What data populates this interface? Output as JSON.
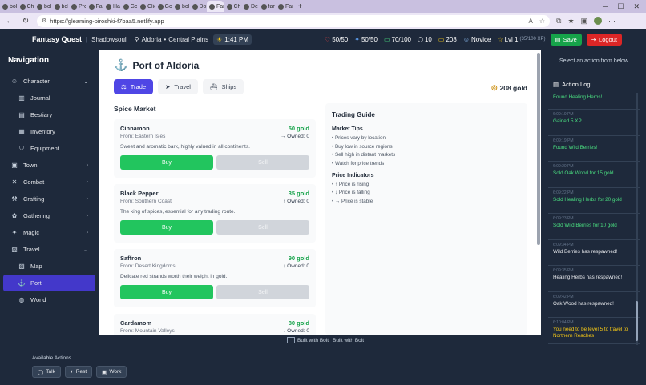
{
  "browser": {
    "tabs": [
      {
        "label": "bolt"
      },
      {
        "label": "Cha"
      },
      {
        "label": "bolt"
      },
      {
        "label": "bolt"
      },
      {
        "label": "Proj"
      },
      {
        "label": "Fant"
      },
      {
        "label": "Hac"
      },
      {
        "label": "Goo"
      },
      {
        "label": "Clie"
      },
      {
        "label": "Goo"
      },
      {
        "label": "bolt"
      },
      {
        "label": "Dom"
      },
      {
        "label": "Fant",
        "active": true
      },
      {
        "label": "Cha"
      },
      {
        "label": "Dev"
      },
      {
        "label": "fant"
      },
      {
        "label": "Fant"
      }
    ],
    "url": "https://gleaming-piroshki-f7baa5.netlify.app"
  },
  "header": {
    "brand": "Fantasy Quest",
    "player": "Shadowsoul",
    "location": "Aldoria",
    "region": "Central Plains",
    "time": "1:41 PM",
    "hp": "50/50",
    "mana": "50/50",
    "stamina": "70/100",
    "stat_o": "10",
    "gold": "208",
    "rank": "Novice",
    "level": "Lvl 1",
    "xp": "(35/100 XP)",
    "save_label": "Save",
    "logout_label": "Logout"
  },
  "sidebar": {
    "title": "Navigation",
    "items": [
      {
        "label": "Character",
        "icon": "user-icon",
        "chev": "⌄"
      },
      {
        "label": "Journal",
        "icon": "book-icon",
        "sub": true
      },
      {
        "label": "Bestiary",
        "icon": "bestiary-icon",
        "sub": true
      },
      {
        "label": "Inventory",
        "icon": "inventory-icon",
        "sub": true
      },
      {
        "label": "Equipment",
        "icon": "shirt-icon",
        "sub": true
      },
      {
        "label": "Town",
        "icon": "town-icon",
        "chev": "›"
      },
      {
        "label": "Combat",
        "icon": "swords-icon",
        "chev": "›"
      },
      {
        "label": "Crafting",
        "icon": "hammer-icon",
        "chev": "›"
      },
      {
        "label": "Gathering",
        "icon": "gathering-icon",
        "chev": "›"
      },
      {
        "label": "Magic",
        "icon": "sparkle-icon",
        "chev": "›"
      },
      {
        "label": "Travel",
        "icon": "map-icon",
        "chev": "⌄"
      },
      {
        "label": "Map",
        "icon": "map-icon",
        "sub": true
      },
      {
        "label": "Port",
        "icon": "anchor-icon",
        "sub": true,
        "active": true
      },
      {
        "label": "World",
        "icon": "globe-icon",
        "sub": true
      }
    ]
  },
  "port": {
    "title": "Port of Aldoria",
    "tabs": [
      {
        "label": "Trade",
        "active": true
      },
      {
        "label": "Travel"
      },
      {
        "label": "Ships"
      }
    ],
    "gold": "208 gold",
    "market_title": "Spice Market",
    "items": [
      {
        "name": "Cinnamon",
        "price": "50 gold",
        "from": "From: Eastern Isles",
        "owned": "→ Owned: 0",
        "desc": "Sweet and aromatic bark, highly valued in all continents."
      },
      {
        "name": "Black Pepper",
        "price": "35 gold",
        "from": "From: Southern Coast",
        "owned": "↑ Owned: 0",
        "desc": "The king of spices, essential for any trading route."
      },
      {
        "name": "Saffron",
        "price": "90 gold",
        "from": "From: Desert Kingdoms",
        "owned": "↓ Owned: 0",
        "desc": "Delicate red strands worth their weight in gold."
      },
      {
        "name": "Cardamom",
        "price": "80 gold",
        "from": "From: Mountain Valleys",
        "owned": "→ Owned: 0",
        "desc": ""
      }
    ],
    "buy_label": "Buy",
    "sell_label": "Sell",
    "guide": {
      "title": "Trading Guide",
      "tips_title": "Market Tips",
      "tips": [
        "• Prices vary by location",
        "• Buy low in source regions",
        "• Sell high in distant markets",
        "• Watch for price trends"
      ],
      "ind_title": "Price Indicators",
      "indicators": [
        "• ↑ Price is rising",
        "• ↓ Price is falling",
        "• → Price is stable"
      ]
    }
  },
  "right": {
    "hint": "Select an action from below",
    "log_title": "Action Log",
    "log": [
      {
        "ts": "",
        "msg": "Found Healing Herbs!",
        "tone": "green"
      },
      {
        "ts": "6:09:19 PM",
        "msg": "Gained 5 XP",
        "tone": "green"
      },
      {
        "ts": "6:09:19 PM",
        "msg": "Found Wild Berries!",
        "tone": "green"
      },
      {
        "ts": "6:09:20 PM",
        "msg": "Sold Oak Wood for 15 gold",
        "tone": "green"
      },
      {
        "ts": "6:09:22 PM",
        "msg": "Sold Healing Herbs for 20 gold",
        "tone": "green"
      },
      {
        "ts": "6:09:23 PM",
        "msg": "Sold Wild Berries for 10 gold",
        "tone": "green"
      },
      {
        "ts": "6:09:34 PM",
        "msg": "Wild Berries has respawned!",
        "tone": "white"
      },
      {
        "ts": "6:09:35 PM",
        "msg": "Healing Herbs has respawned!",
        "tone": "white"
      },
      {
        "ts": "6:09:42 PM",
        "msg": "Oak Wood has respawned!",
        "tone": "white"
      },
      {
        "ts": "6:10:04 PM",
        "msg": "You need to be level 5 to travel to Northern Reaches",
        "tone": "yellow"
      }
    ]
  },
  "footer": {
    "bolt": "Built with Bolt",
    "bolt_alt": "Built with Bolt",
    "available": "Available Actions",
    "actions": [
      {
        "label": "Talk",
        "icon": "chat-icon"
      },
      {
        "label": "Rest",
        "icon": "rest-icon"
      },
      {
        "label": "Work",
        "icon": "briefcase-icon"
      }
    ]
  },
  "colors": {
    "accent": "#4f46e5",
    "buy": "#22c55e",
    "save": "#16a34a",
    "logout": "#dc2626",
    "bg_dark": "#1e293b"
  }
}
